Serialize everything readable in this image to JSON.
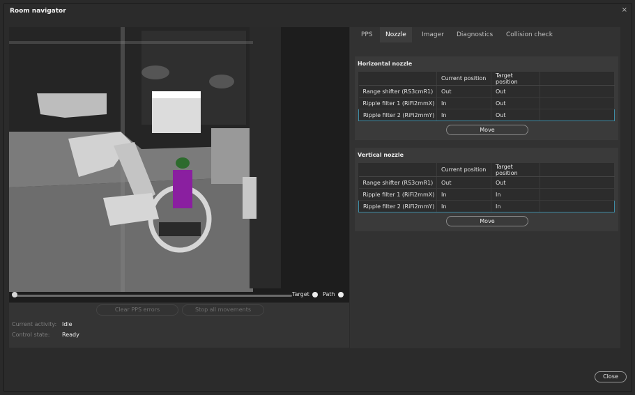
{
  "window": {
    "title": "Room navigator",
    "close_glyph": "×"
  },
  "viewport": {
    "target_label": "Target",
    "path_label": "Path"
  },
  "controls": {
    "clear_pps_errors": "Clear PPS errors",
    "stop_all_movements": "Stop all movements",
    "current_activity_label": "Current activity:",
    "current_activity_value": "Idle",
    "control_state_label": "Control state:",
    "control_state_value": "Ready"
  },
  "tabs": [
    {
      "label": "PPS",
      "active": false
    },
    {
      "label": "Nozzle",
      "active": true
    },
    {
      "label": "Imager",
      "active": false
    },
    {
      "label": "Diagnostics",
      "active": false
    },
    {
      "label": "Collision check",
      "active": false
    }
  ],
  "horizontal_nozzle": {
    "title": "Horizontal nozzle",
    "columns": [
      "",
      "Current position",
      "Target position"
    ],
    "rows": [
      {
        "name": "Range shifter (RS3cmR1)",
        "current": "Out",
        "target": "Out"
      },
      {
        "name": "Ripple filter 1 (RiFi2mmX)",
        "current": "In",
        "target": "Out"
      },
      {
        "name": "Ripple filter 2 (RiFi2mmY)",
        "current": "In",
        "target": "Out"
      }
    ],
    "move_label": "Move"
  },
  "vertical_nozzle": {
    "title": "Vertical nozzle",
    "columns": [
      "",
      "Current position",
      "Target position"
    ],
    "rows": [
      {
        "name": "Range shifter (RS3cmR1)",
        "current": "Out",
        "target": "Out"
      },
      {
        "name": "Ripple filter 1 (RiFi2mmX)",
        "current": "In",
        "target": "In"
      },
      {
        "name": "Ripple filter 2 (RiFi2mmY)",
        "current": "In",
        "target": "In"
      }
    ],
    "move_label": "Move"
  },
  "footer": {
    "close_label": "Close"
  },
  "colors": {
    "accent": "#3f8ca5",
    "patient": "#8a1fa0"
  }
}
